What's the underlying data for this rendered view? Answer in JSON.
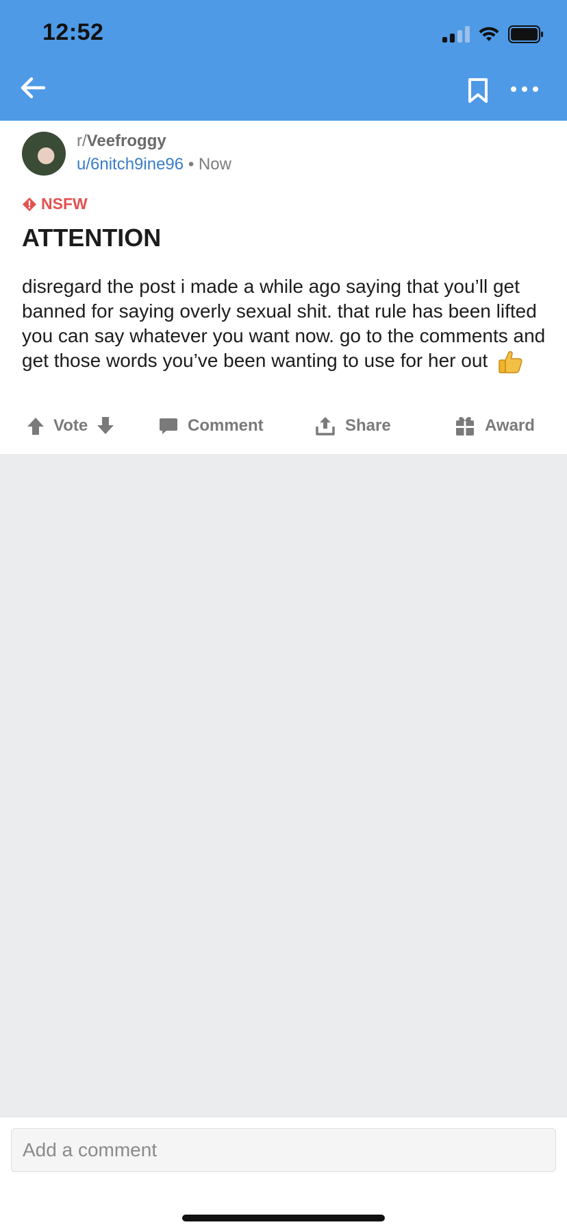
{
  "status_bar": {
    "time": "12:52"
  },
  "post": {
    "subreddit_prefix": "r/",
    "subreddit": "Veefroggy",
    "author": "u/6nitch9ine96",
    "separator": "•",
    "time": "Now",
    "flag": "NSFW",
    "title": "ATTENTION",
    "body": "disregard the post i made a while ago saying that you’ll get banned for saying overly sexual shit. that rule has been lifted you can say whatever you want now. go to the comments and get those words you’ve been wanting to use for her out"
  },
  "actions": {
    "vote": "Vote",
    "comment": "Comment",
    "share": "Share",
    "award": "Award"
  },
  "comment_box": {
    "placeholder": "Add a comment"
  },
  "icons": {
    "back": "arrow-left-icon",
    "bookmark": "bookmark-icon",
    "more": "more-dots-icon",
    "nsfw": "warning-diamond-icon",
    "upvote": "arrow-up-icon",
    "downvote": "arrow-down-icon",
    "comment": "speech-bubble-icon",
    "share": "share-upload-icon",
    "award": "gift-icon",
    "emoji": "thumbs-up-emoji"
  },
  "colors": {
    "header": "#4e9ae6",
    "nsfw": "#e3524f",
    "username": "#3a7cc4"
  }
}
